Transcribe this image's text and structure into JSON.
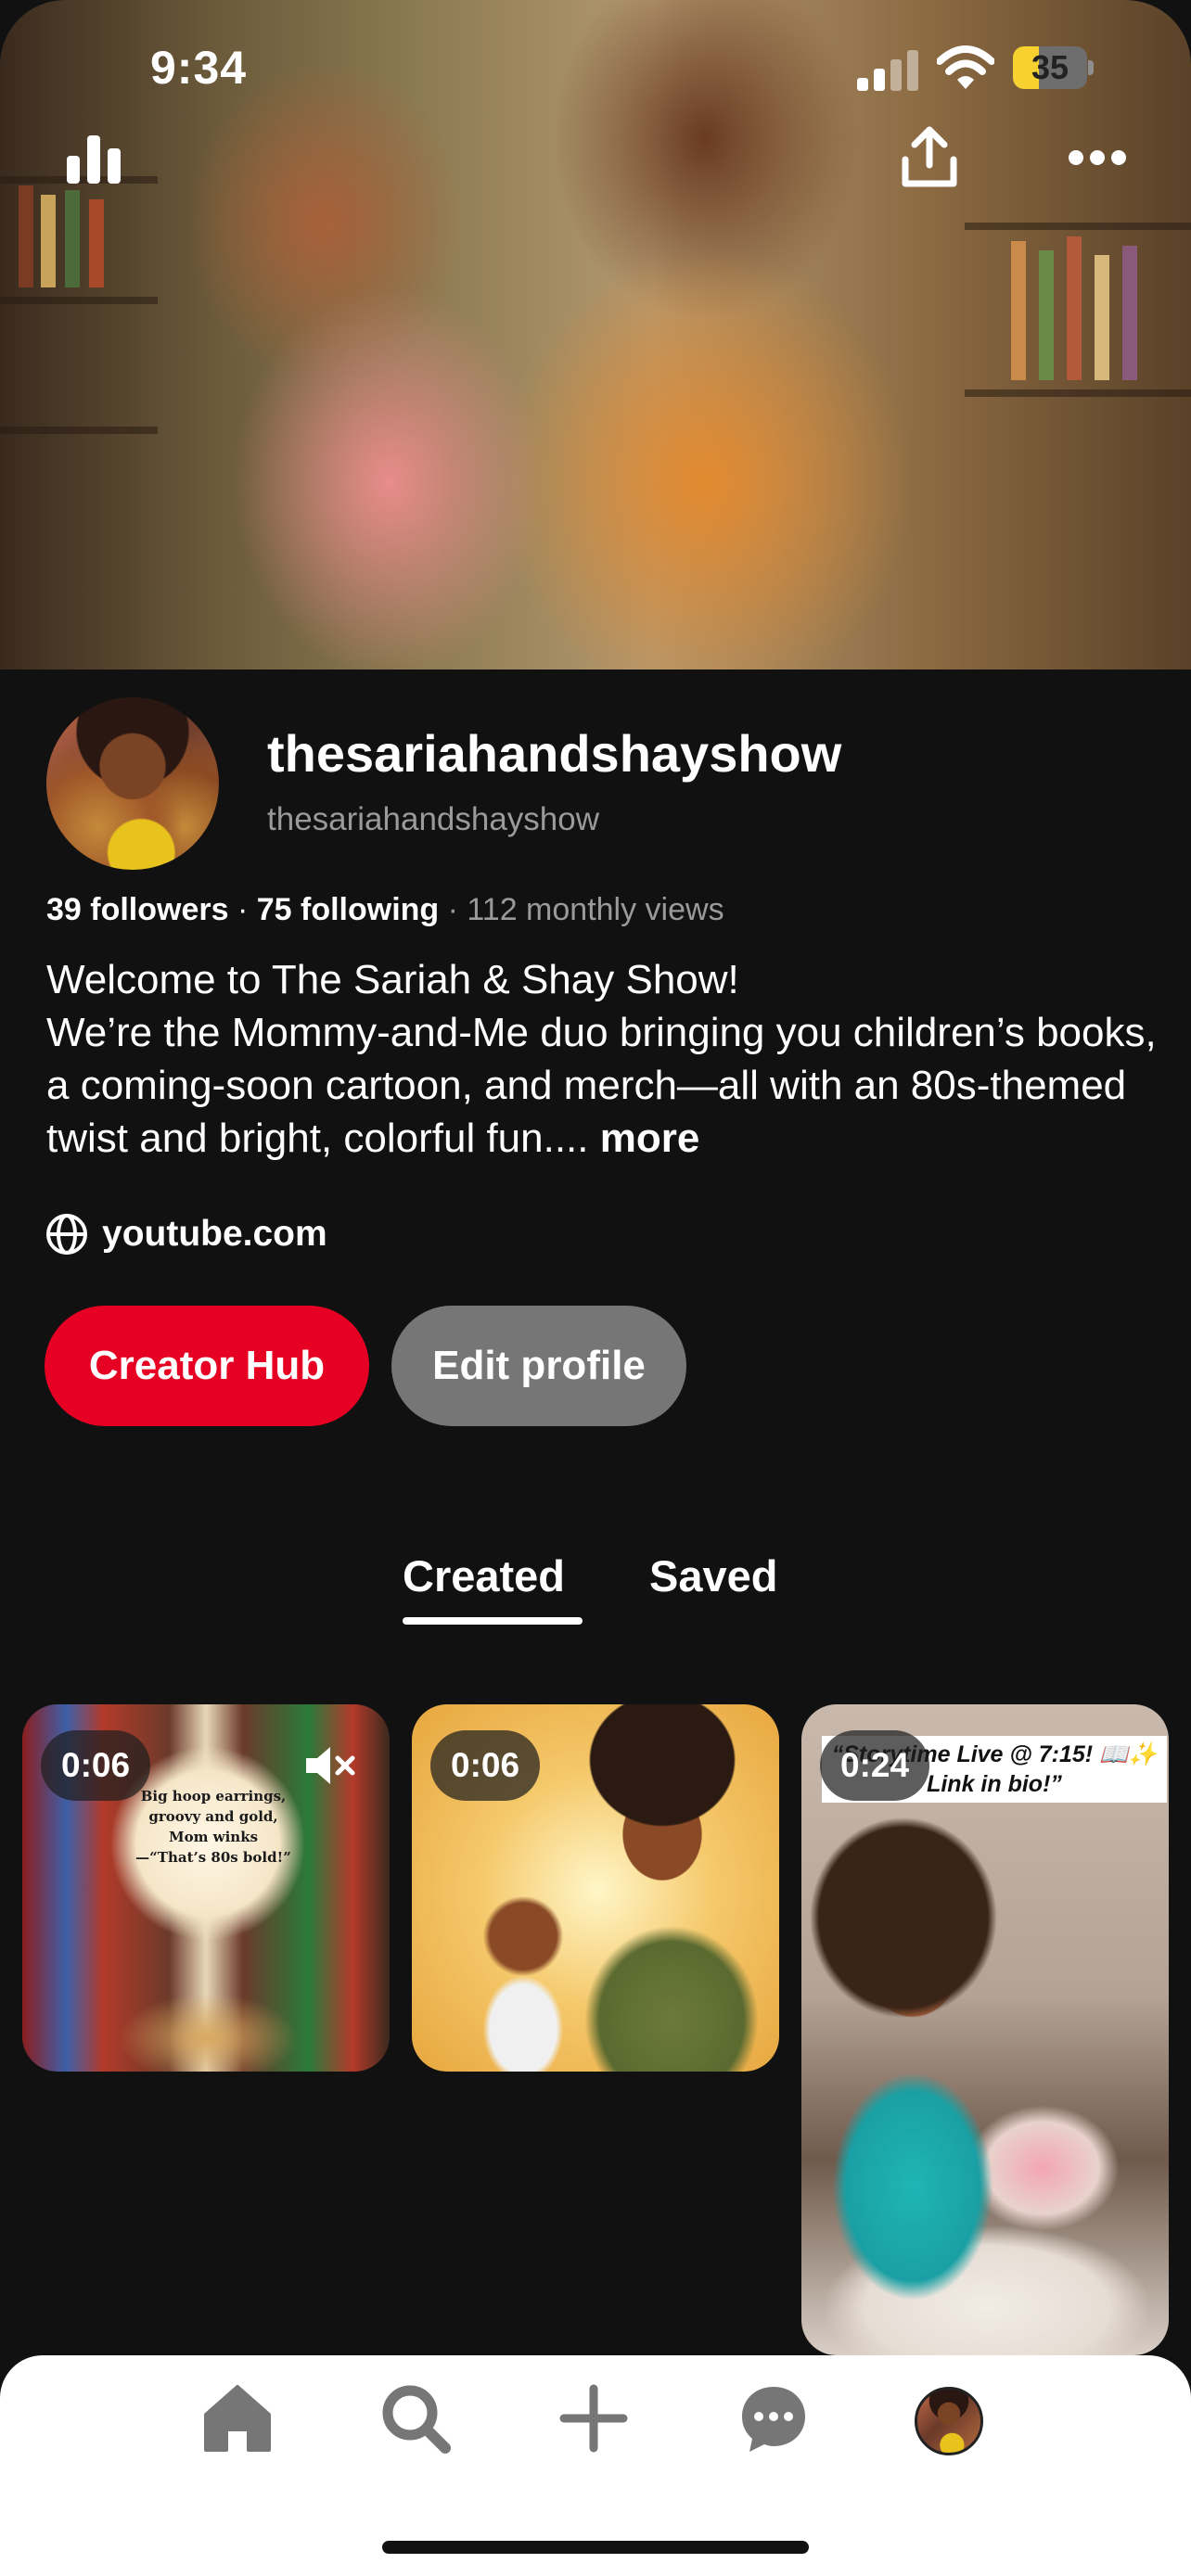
{
  "status_bar": {
    "time": "9:34",
    "battery_level": "35",
    "battery_fraction": 0.35,
    "battery_color": "#f6d130"
  },
  "header": {
    "icons": [
      "stats-icon",
      "share-icon",
      "more-icon"
    ]
  },
  "profile": {
    "display_name": "thesariahandshayshow",
    "handle": "thesariahandshayshow",
    "followers": "39 followers",
    "following": "75 following",
    "monthly_views": "112 monthly views",
    "bio_line_1": "Welcome to The Sariah & Shay Show!",
    "bio_line_2": "We’re the Mommy-and-Me duo bringing you children’s books, a coming-soon cartoon, and merch—all with an 80s-themed twist and bright, colorful fun.... ",
    "bio_more": "more",
    "website": "youtube.com",
    "website_icon": "globe-icon"
  },
  "buttons": {
    "creator_hub": "Creator Hub",
    "edit_profile": "Edit profile",
    "creator_hub_color": "#e60023",
    "edit_profile_color": "#767676"
  },
  "tabs": {
    "created": "Created",
    "saved": "Saved",
    "active": "Created"
  },
  "pins": [
    {
      "duration": "0:06",
      "caption": "Big hoop earrings, groovy and gold, Mom winks —“That’s 80s bold!”",
      "muted": true
    },
    {
      "duration": "0:06"
    },
    {
      "duration": "0:24",
      "caption": "“Storytime Live @ 7:15! 📖✨ Link in bio!”"
    }
  ],
  "bottom_nav": {
    "items": [
      "home-icon",
      "search-icon",
      "create-icon",
      "messages-icon",
      "profile-avatar"
    ],
    "background": "#ffffff"
  }
}
